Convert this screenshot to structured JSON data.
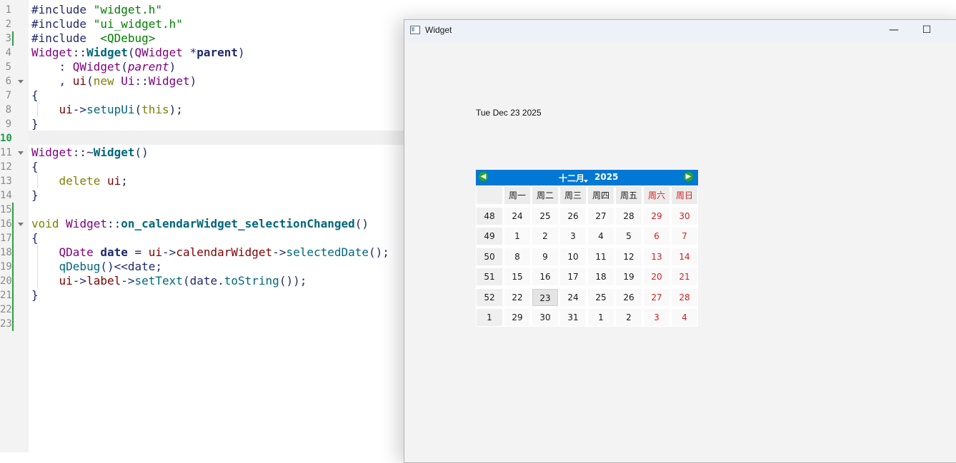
{
  "editor": {
    "line_numbers": [
      "1",
      "2",
      "3",
      "4",
      "5",
      "6",
      "7",
      "8",
      "9",
      "10",
      "11",
      "12",
      "13",
      "14",
      "15",
      "16",
      "17",
      "18",
      "19",
      "20",
      "21",
      "22",
      "23"
    ]
  },
  "window": {
    "title": "Widget",
    "minimize_glyph": "—",
    "maximize_glyph": "☐",
    "close_glyph": "✕"
  },
  "label": {
    "text": "Tue Dec 23 2025"
  },
  "calendar": {
    "month": "十二月",
    "year": "2025",
    "prev_icon": "◀",
    "next_icon": "▶",
    "headers": [
      "周一",
      "周二",
      "周三",
      "周四",
      "周五",
      "周六",
      "周日"
    ],
    "weeks": [
      {
        "num": "48",
        "days": [
          "24",
          "25",
          "26",
          "27",
          "28",
          "29",
          "30"
        ]
      },
      {
        "num": "49",
        "days": [
          "1",
          "2",
          "3",
          "4",
          "5",
          "6",
          "7"
        ]
      },
      {
        "num": "50",
        "days": [
          "8",
          "9",
          "10",
          "11",
          "12",
          "13",
          "14"
        ]
      },
      {
        "num": "51",
        "days": [
          "15",
          "16",
          "17",
          "18",
          "19",
          "20",
          "21"
        ]
      },
      {
        "num": "52",
        "days": [
          "22",
          "23",
          "24",
          "25",
          "26",
          "27",
          "28"
        ]
      },
      {
        "num": "1",
        "days": [
          "29",
          "30",
          "31",
          "1",
          "2",
          "3",
          "4"
        ]
      }
    ],
    "selected_date": "23",
    "colors": {
      "nav": "#0078d4",
      "weekend": "#d42020",
      "arrow": "#2aa52a"
    }
  }
}
